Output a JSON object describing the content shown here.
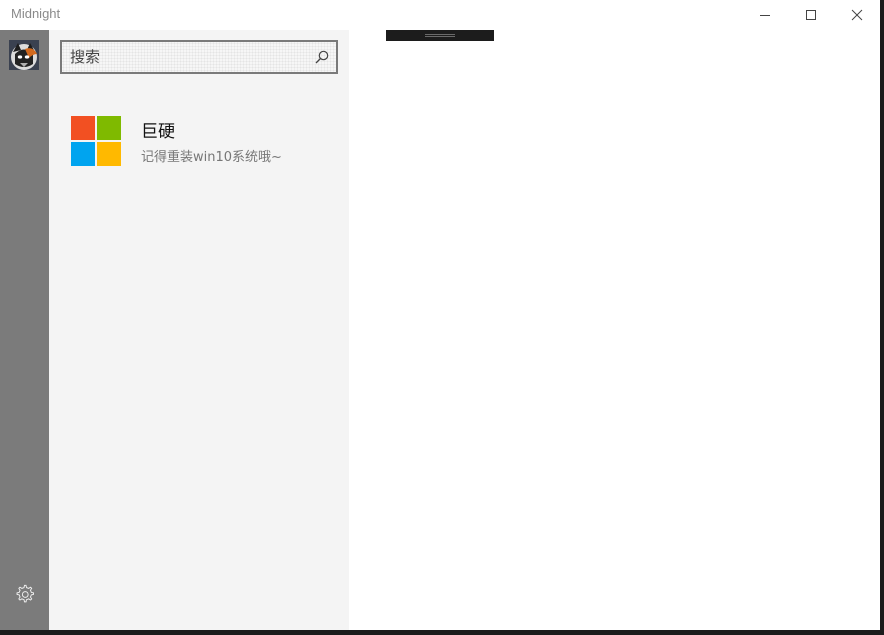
{
  "window": {
    "title": "Midnight"
  },
  "search": {
    "placeholder": "搜索"
  },
  "contacts": [
    {
      "name": "巨硬",
      "message": "记得重装win10系统哦~",
      "avatar_icon": "microsoft-logo-icon",
      "avatar_colors": [
        "#f25022",
        "#7fba00",
        "#00a4ef",
        "#ffb900"
      ]
    }
  ],
  "icons": {
    "settings": "gear-icon",
    "search": "search-icon",
    "minimize": "minimize-icon",
    "maximize": "maximize-icon",
    "close": "close-icon",
    "user_avatar": "user-avatar"
  },
  "colors": {
    "rail": "#7b7b7b",
    "list_pane": "#f4f4f4",
    "main": "#ffffff"
  }
}
